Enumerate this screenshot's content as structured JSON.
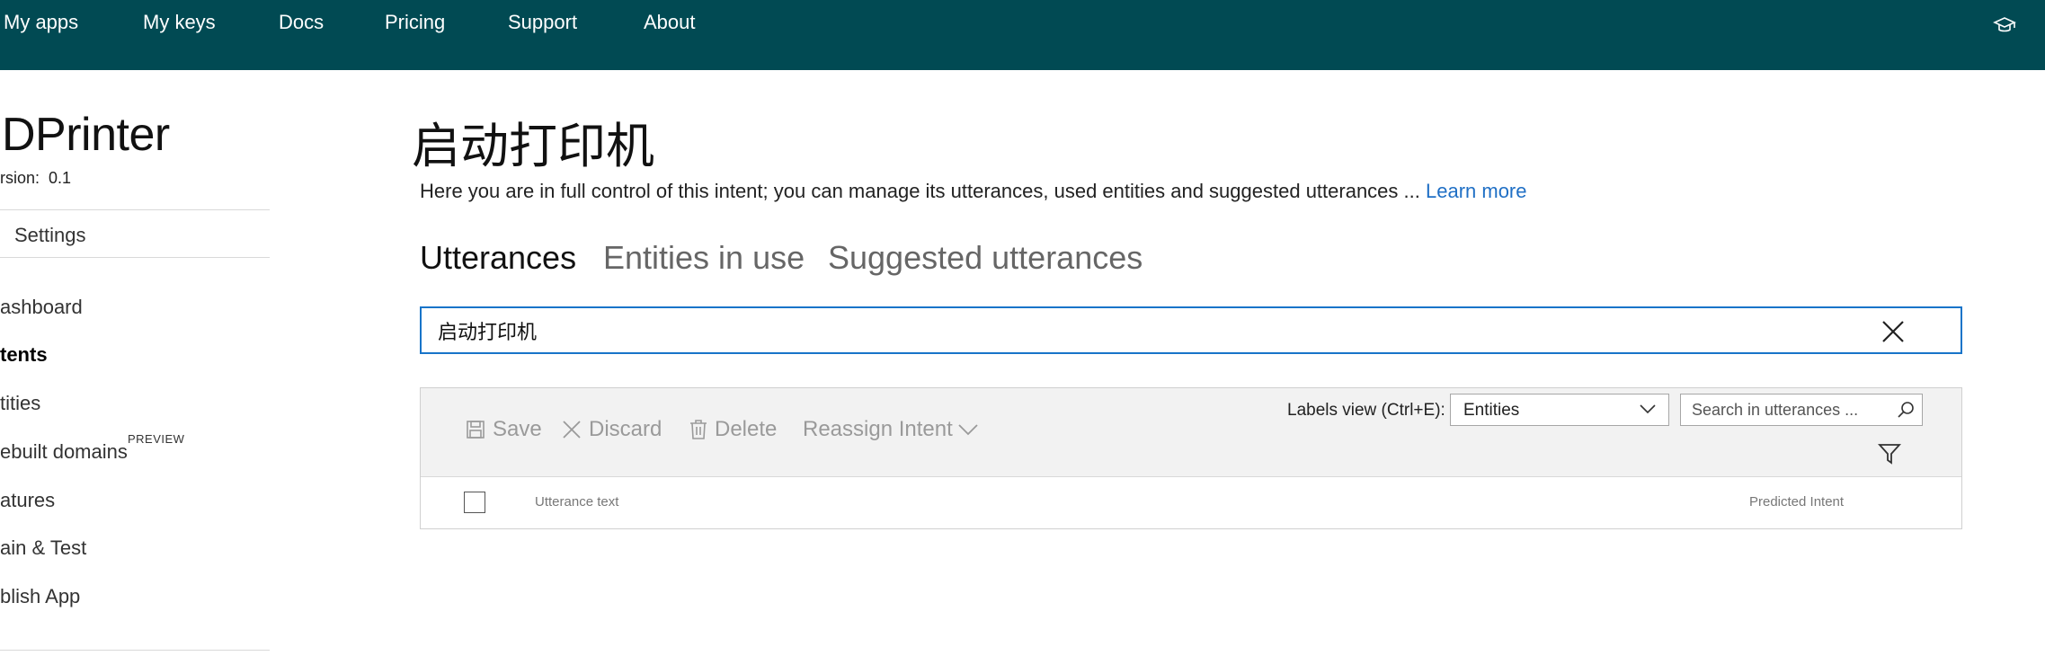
{
  "topnav": {
    "links": [
      "My apps",
      "My keys",
      "Docs",
      "Pricing",
      "Support",
      "About"
    ],
    "learn_icon": "graduation-cap-icon",
    "background": "#014a53"
  },
  "sidebar": {
    "app_name": "DPrinter",
    "version_label": "rsion:",
    "version_value": "0.1",
    "settings": "Settings",
    "items": [
      {
        "label": "ashboard",
        "active": false
      },
      {
        "label": "tents",
        "active": true
      },
      {
        "label": "tities",
        "active": false
      },
      {
        "label": "ebuilt domains",
        "active": false
      },
      {
        "label": "atures",
        "active": false
      },
      {
        "label": "ain & Test",
        "active": false
      },
      {
        "label": "blish App",
        "active": false
      }
    ],
    "preview_badge": "PREVIEW"
  },
  "main": {
    "title": "启动打印机",
    "description": "Here you are in full control of this intent; you can manage its utterances, used entities and suggested utterances ... ",
    "learn_more": "Learn more",
    "tabs": [
      {
        "label": "Utterances",
        "active": true
      },
      {
        "label": "Entities in use",
        "active": false
      },
      {
        "label": "Suggested utterances",
        "active": false
      }
    ],
    "utterance_input": {
      "value": "启动打印机"
    },
    "toolbar": {
      "save": "Save",
      "discard": "Discard",
      "delete": "Delete",
      "reassign": "Reassign Intent",
      "labels_view_label": "Labels view (Ctrl+E):",
      "labels_view_value": "Entities",
      "search_placeholder": "Search in utterances ..."
    },
    "grid": {
      "columns": [
        "Utterance text",
        "Predicted Intent"
      ]
    }
  },
  "colors": {
    "accent": "#1874c9",
    "link": "#1f6fc5",
    "disabled": "#9a9a9a"
  }
}
